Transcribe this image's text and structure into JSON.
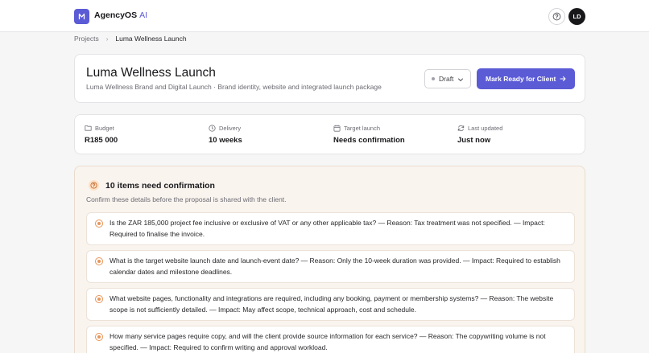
{
  "app": {
    "brand": "AgencyOS",
    "brand_suffix": "AI",
    "brand_color": "#5b5bd6",
    "help_icon": "question-circle-icon",
    "user_initials": "LD"
  },
  "breadcrumb": {
    "parent": "Projects",
    "current": "Luma Wellness Launch"
  },
  "project": {
    "title": "Luma Wellness Launch",
    "subtitle": "Luma Wellness Brand and Digital Launch · Brand identity, website and integrated launch package",
    "status": "Draft",
    "primary_action": "Mark Ready for Client"
  },
  "stats": [
    {
      "label": "Budget",
      "value": "R185 000",
      "icon": "folder-icon"
    },
    {
      "label": "Delivery",
      "value": "10 weeks",
      "icon": "clock-icon"
    },
    {
      "label": "Target launch",
      "value": "Needs confirmation",
      "icon": "calendar-icon"
    },
    {
      "label": "Last updated",
      "value": "Just now",
      "icon": "refresh-icon"
    }
  ],
  "confirmations": {
    "heading": "10 items need confirmation",
    "subheading": "Confirm these details before the proposal is shared with the client.",
    "accent_color": "#e8955a",
    "items": [
      "Is the ZAR 185,000 project fee inclusive or exclusive of VAT or any other applicable tax? — Reason: Tax treatment was not specified. — Impact: Required to finalise the invoice.",
      "What is the target website launch date and launch-event date? — Reason: Only the 10-week duration was provided. — Impact: Required to establish calendar dates and milestone deadlines.",
      "What website pages, functionality and integrations are required, including any booking, payment or membership systems? — Reason: The website scope is not sufficiently detailed. — Impact: May affect scope, technical approach, cost and schedule.",
      "How many service pages require copy, and will the client provide source information for each service? — Reason: The copywriting volume is not specified. — Impact: Required to confirm writing and approval workload."
    ]
  }
}
